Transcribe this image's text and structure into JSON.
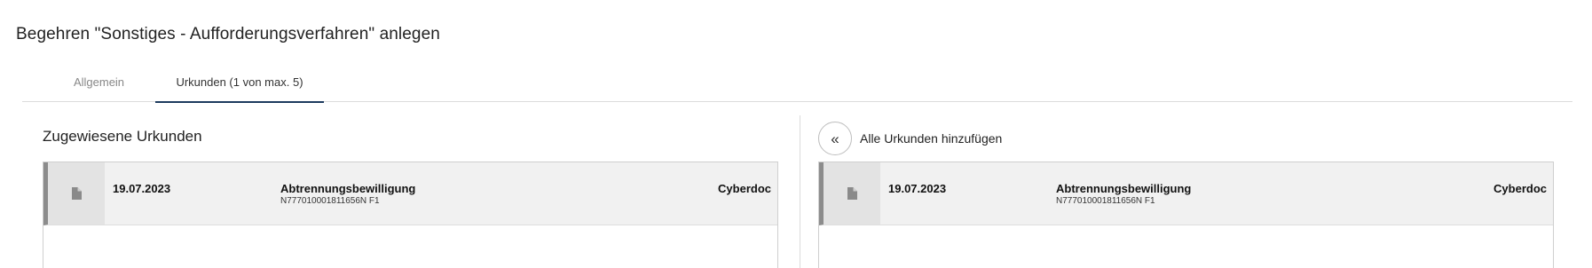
{
  "page": {
    "title": "Begehren \"Sonstiges - Aufforderungsverfahren\" anlegen"
  },
  "tabs": [
    {
      "label": "Allgemein",
      "active": false
    },
    {
      "label": "Urkunden (1 von max. 5)",
      "active": true
    }
  ],
  "assigned": {
    "heading": "Zugewiesene Urkunden",
    "documents": [
      {
        "icon": "document-icon",
        "date": "19.07.2023",
        "title": "Abtrennungsbewilligung",
        "number": "N777010001811656N F1",
        "source": "Cyberdoc"
      }
    ]
  },
  "available": {
    "add_all_icon": "double-chevron-left-icon",
    "add_all_glyph": "«",
    "add_all_label": "Alle Urkunden hinzufügen",
    "documents": [
      {
        "icon": "document-icon",
        "date": "19.07.2023",
        "title": "Abtrennungsbewilligung",
        "number": "N777010001811656N F1",
        "source": "Cyberdoc"
      }
    ]
  },
  "colors": {
    "active_tab_underline": "#1c3a5e",
    "row_background": "#f1f1f1",
    "row_accent": "#8c8c8c"
  }
}
